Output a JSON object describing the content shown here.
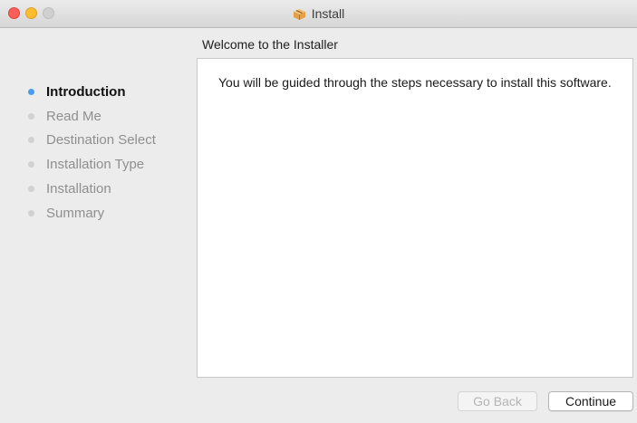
{
  "window": {
    "title": "Install",
    "title_icon": "package-icon"
  },
  "pane": {
    "title": "Welcome to the  Installer",
    "body": "You will be guided through the steps necessary to install this software."
  },
  "steps": [
    {
      "label": "Introduction",
      "active": true
    },
    {
      "label": "Read Me",
      "active": false
    },
    {
      "label": "Destination Select",
      "active": false
    },
    {
      "label": "Installation Type",
      "active": false
    },
    {
      "label": "Installation",
      "active": false
    },
    {
      "label": "Summary",
      "active": false
    }
  ],
  "buttons": {
    "go_back": "Go Back",
    "continue": "Continue"
  },
  "colors": {
    "active_dot": "#4a9cf1",
    "inactive_dot": "#d1d1d1",
    "close": "#fc5d57",
    "minimize": "#fdbc2e"
  }
}
